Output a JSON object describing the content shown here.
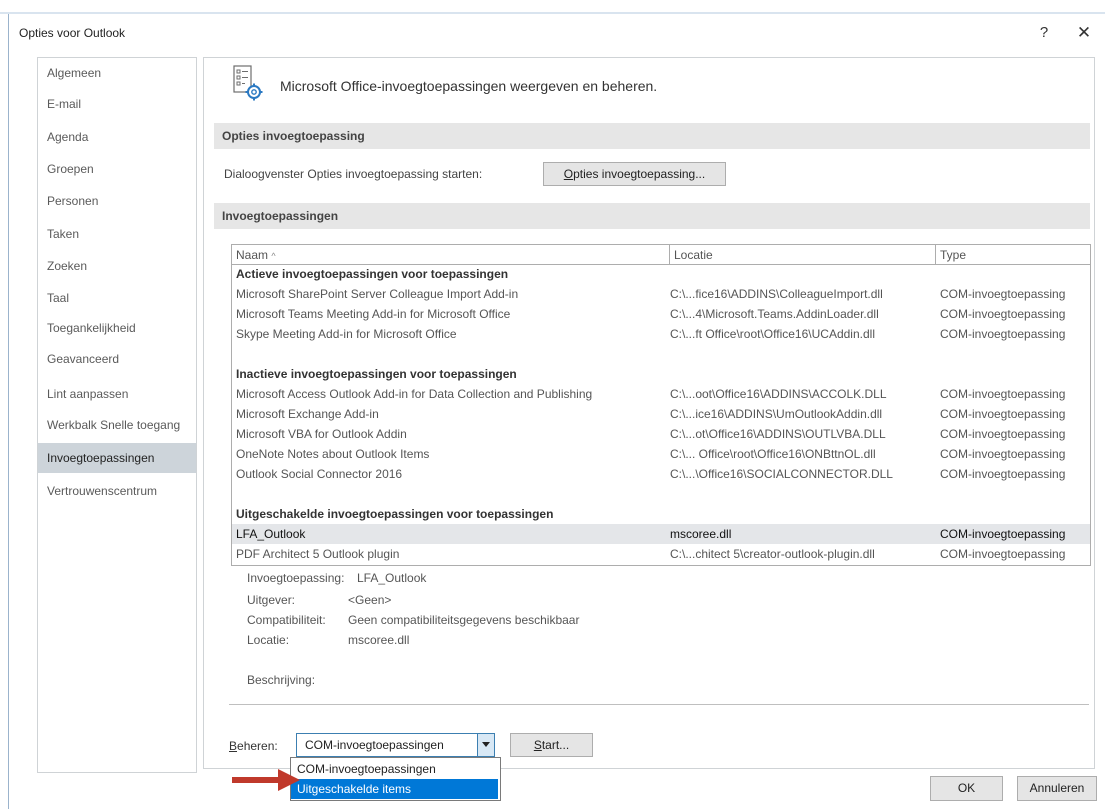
{
  "window": {
    "title": "Opties voor Outlook",
    "help_label": "?",
    "close_label": "✕"
  },
  "sidebar": {
    "items": [
      {
        "label": "Algemeen"
      },
      {
        "label": "E-mail"
      },
      {
        "label": "Agenda"
      },
      {
        "label": "Groepen"
      },
      {
        "label": "Personen"
      },
      {
        "label": "Taken"
      },
      {
        "label": "Zoeken"
      },
      {
        "label": "Taal"
      },
      {
        "label": "Toegankelijkheid"
      },
      {
        "label": "Geavanceerd"
      },
      {
        "label": "Lint aanpassen"
      },
      {
        "label": "Werkbalk Snelle toegang"
      },
      {
        "label": "Invoegtoepassingen",
        "selected": true
      },
      {
        "label": "Vertrouwenscentrum"
      }
    ]
  },
  "header": {
    "icon": "addins-gear-icon",
    "text": "Microsoft Office-invoegtoepassingen weergeven en beheren."
  },
  "options_section": {
    "title": "Opties invoegtoepassing",
    "label": "Dialoogvenster Opties invoegtoepassing starten:",
    "button_accel": "O",
    "button_rest": "pties invoegtoepassing..."
  },
  "addins_section": {
    "title": "Invoegtoepassingen"
  },
  "grid": {
    "columns": {
      "name": "Naam",
      "sort_indicator": "^",
      "location": "Locatie",
      "type": "Type"
    },
    "groups": [
      {
        "title": "Actieve invoegtoepassingen voor toepassingen",
        "rows": [
          {
            "name": "Microsoft SharePoint Server Colleague Import Add-in",
            "location": "C:\\...fice16\\ADDINS\\ColleagueImport.dll",
            "type": "COM-invoegtoepassing"
          },
          {
            "name": "Microsoft Teams Meeting Add-in for Microsoft Office",
            "location": "C:\\...4\\Microsoft.Teams.AddinLoader.dll",
            "type": "COM-invoegtoepassing"
          },
          {
            "name": "Skype Meeting Add-in for Microsoft Office",
            "location": "C:\\...ft Office\\root\\Office16\\UCAddin.dll",
            "type": "COM-invoegtoepassing"
          }
        ]
      },
      {
        "title": "Inactieve invoegtoepassingen voor toepassingen",
        "rows": [
          {
            "name": "Microsoft Access Outlook Add-in for Data Collection and Publishing",
            "location": "C:\\...oot\\Office16\\ADDINS\\ACCOLK.DLL",
            "type": "COM-invoegtoepassing"
          },
          {
            "name": "Microsoft Exchange Add-in",
            "location": "C:\\...ice16\\ADDINS\\UmOutlookAddin.dll",
            "type": "COM-invoegtoepassing"
          },
          {
            "name": "Microsoft VBA for Outlook Addin",
            "location": "C:\\...ot\\Office16\\ADDINS\\OUTLVBA.DLL",
            "type": "COM-invoegtoepassing"
          },
          {
            "name": "OneNote Notes about Outlook Items",
            "location": "C:\\... Office\\root\\Office16\\ONBttnOL.dll",
            "type": "COM-invoegtoepassing"
          },
          {
            "name": "Outlook Social Connector 2016",
            "location": "C:\\...\\Office16\\SOCIALCONNECTOR.DLL",
            "type": "COM-invoegtoepassing"
          }
        ]
      },
      {
        "title": "Uitgeschakelde invoegtoepassingen voor toepassingen",
        "rows": [
          {
            "name": "LFA_Outlook",
            "location": "mscoree.dll",
            "type": "COM-invoegtoepassing",
            "selected": true
          },
          {
            "name": "PDF Architect 5 Outlook plugin",
            "location": "C:\\...chitect 5\\creator-outlook-plugin.dll",
            "type": "COM-invoegtoepassing"
          }
        ]
      }
    ]
  },
  "details": {
    "addin_label": "Invoegtoepassing:",
    "addin_value": "LFA_Outlook",
    "publisher_label": "Uitgever:",
    "publisher_value": "<Geen>",
    "compat_label": "Compatibiliteit:",
    "compat_value": "Geen compatibiliteitsgegevens beschikbaar",
    "location_label": "Locatie:",
    "location_value": "mscoree.dll",
    "description_label": "Beschrijving:"
  },
  "manage": {
    "label_accel": "B",
    "label_rest": "eheren:",
    "selected": "COM-invoegtoepassingen",
    "start_accel": "S",
    "start_rest": "tart...",
    "options": [
      {
        "label": "COM-invoegtoepassingen"
      },
      {
        "label": "Uitgeschakelde items",
        "highlighted": true
      }
    ]
  },
  "footer": {
    "ok_label": "OK",
    "cancel_label": "Annuleren"
  },
  "colors": {
    "selection_blue": "#0078d7",
    "arrow_red": "#c0392b",
    "sidebar_selected": "#cdd4da",
    "section_bar": "#e6e6e6"
  }
}
